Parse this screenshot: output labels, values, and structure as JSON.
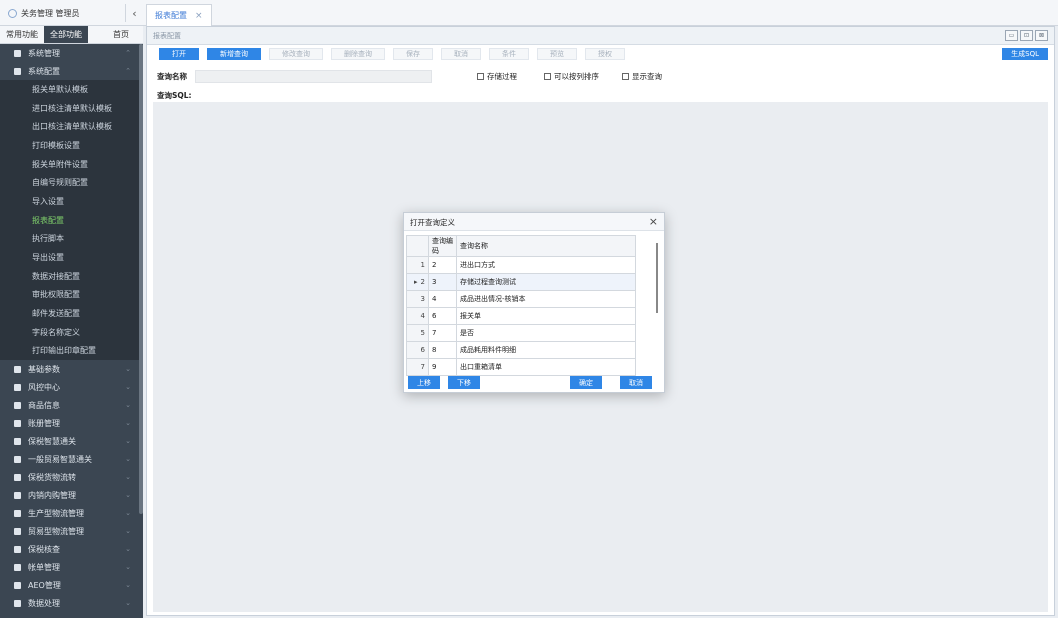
{
  "app": {
    "title": "关务管理 管理员",
    "collapse_icon": "‹"
  },
  "tabs": [
    {
      "label": "报表配置",
      "close": "×"
    }
  ],
  "sidebar": {
    "tabs": [
      "常用功能",
      "全部功能",
      "首页"
    ],
    "sections": [
      {
        "label": "系统管理",
        "icon": "grid-icon"
      },
      {
        "label": "系统配置",
        "icon": "config-icon",
        "items": [
          "报关单默认模板",
          "进口核注清单默认模板",
          "出口核注清单默认模板",
          "打印模板设置",
          "报关单附件设置",
          "自编号规则配置",
          "导入设置",
          "报表配置",
          "执行脚本",
          "导出设置",
          "数据对接配置",
          "审批权限配置",
          "邮件发送配置",
          "字段名称定义",
          "打印输出印章配置"
        ],
        "active": "报表配置"
      }
    ],
    "sections_after": [
      "基础参数",
      "风控中心",
      "商品信息",
      "账册管理",
      "保税智慧通关",
      "一般贸易智慧通关",
      "保税货物流转",
      "内销内购管理",
      "生产型物流管理",
      "贸易型物流管理",
      "保税核查",
      "帐单管理",
      "AEO管理",
      "数据处理"
    ]
  },
  "main": {
    "title": "报表配置",
    "toolbar": [
      "打开",
      "新增查询",
      "修改查询",
      "删除查询",
      "保存",
      "取消",
      "条件",
      "预览",
      "授权"
    ],
    "generate_sql": "生成SQL",
    "query_name_label": "查询名称",
    "query_name_value": "",
    "checkboxes": [
      "存储过程",
      "可以按列排序",
      "显示查询"
    ],
    "sql_label": "查询SQL:"
  },
  "modal": {
    "title": "打开查询定义",
    "close": "×",
    "columns": [
      "查询编码",
      "查询名称"
    ],
    "rows": [
      {
        "n": "1",
        "code": "2",
        "name": "进出口方式",
        "selected": false
      },
      {
        "n": "2",
        "code": "3",
        "name": "存储过程查询测试",
        "selected": true
      },
      {
        "n": "3",
        "code": "4",
        "name": "成品进出情况-核销本",
        "selected": false
      },
      {
        "n": "4",
        "code": "6",
        "name": "报关单",
        "selected": false
      },
      {
        "n": "5",
        "code": "7",
        "name": "是否",
        "selected": false
      },
      {
        "n": "6",
        "code": "8",
        "name": "成品耗用料件明细",
        "selected": false
      },
      {
        "n": "7",
        "code": "9",
        "name": "出口重箱清单",
        "selected": false
      }
    ],
    "buttons": {
      "up": "上移",
      "down": "下移",
      "ok": "确定",
      "cancel": "取消"
    },
    "selected_marker": "▸"
  }
}
